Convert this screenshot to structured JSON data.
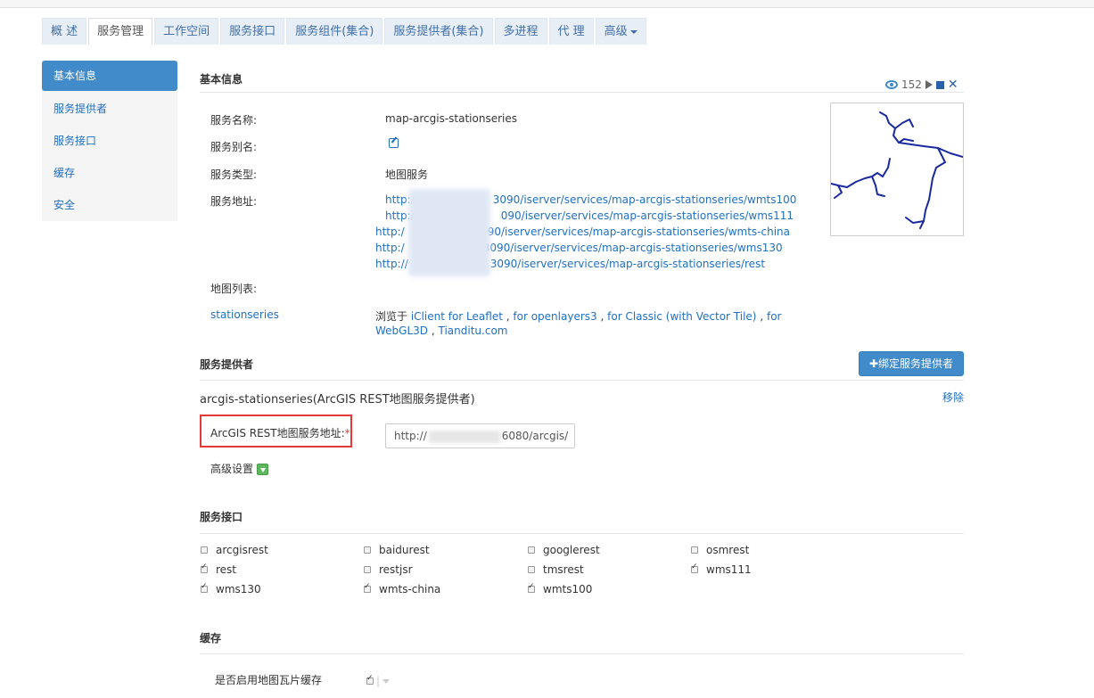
{
  "tabs": [
    {
      "label": "概 述"
    },
    {
      "label": "服务管理"
    },
    {
      "label": "工作空间"
    },
    {
      "label": "服务接口"
    },
    {
      "label": "服务组件(集合)"
    },
    {
      "label": "服务提供者(集合)"
    },
    {
      "label": "多进程"
    },
    {
      "label": "代 理"
    },
    {
      "label": "高级"
    }
  ],
  "active_tab": "服务管理",
  "sidebar": {
    "items": [
      {
        "label": "基本信息"
      },
      {
        "label": "服务提供者"
      },
      {
        "label": "服务接口"
      },
      {
        "label": "缓存"
      },
      {
        "label": "安全"
      }
    ],
    "active": "基本信息"
  },
  "basic": {
    "title": "基本信息",
    "view_count": "152",
    "name_label": "服务名称:",
    "name_value": "map-arcgis-stationseries",
    "alias_label": "服务别名:",
    "type_label": "服务类型:",
    "type_value": "地图服务",
    "address_label": "服务地址:",
    "urls": [
      "http://",
      "3090/iserver/services/map-arcgis-stationseries/wmts100",
      "http://",
      "090/iserver/services/map-arcgis-stationseries/wms111",
      "http:/",
      "90/iserver/services/map-arcgis-stationseries/wmts-china",
      "http:/",
      "3090/iserver/services/map-arcgis-stationseries/wms130",
      "http://",
      "3090/iserver/services/map-arcgis-stationseries/rest"
    ],
    "maplist_label": "地图列表:",
    "map_name": "stationseries",
    "browse_prefix": "浏览于",
    "browse_links": [
      "iClient for Leaflet",
      "for openlayers3",
      "for Classic (with Vector Tile)",
      "for",
      "WebGL3D",
      "Tianditu.com"
    ],
    "sep": ",",
    "line_color": "#1a2a9e"
  },
  "provider": {
    "title": "服务提供者",
    "bind_button": "绑定服务提供者",
    "provider_name": "arcgis-stationseries(ArcGIS REST地图服务提供者)",
    "remove_link": "移除",
    "arcgis_label": "ArcGIS REST地图服务地址:",
    "required_mark": "*",
    "arcgis_value_prefix": "http://",
    "arcgis_value_suffix": "6080/arcgis/",
    "advanced_label": "高级设置"
  },
  "interfaces": {
    "title": "服务接口",
    "items": [
      {
        "label": "arcgisrest",
        "checked": false
      },
      {
        "label": "baidurest",
        "checked": false
      },
      {
        "label": "googlerest",
        "checked": false
      },
      {
        "label": "osmrest",
        "checked": false
      },
      {
        "label": "rest",
        "checked": true
      },
      {
        "label": "restjsr",
        "checked": false
      },
      {
        "label": "tmsrest",
        "checked": false
      },
      {
        "label": "wms111",
        "checked": true
      },
      {
        "label": "wms130",
        "checked": true
      },
      {
        "label": "wmts-china",
        "checked": true
      },
      {
        "label": "wmts100",
        "checked": true
      }
    ]
  },
  "cache": {
    "title": "缓存",
    "tile_cache_label": "是否启用地图瓦片缓存",
    "tile_cache_enabled": true
  }
}
